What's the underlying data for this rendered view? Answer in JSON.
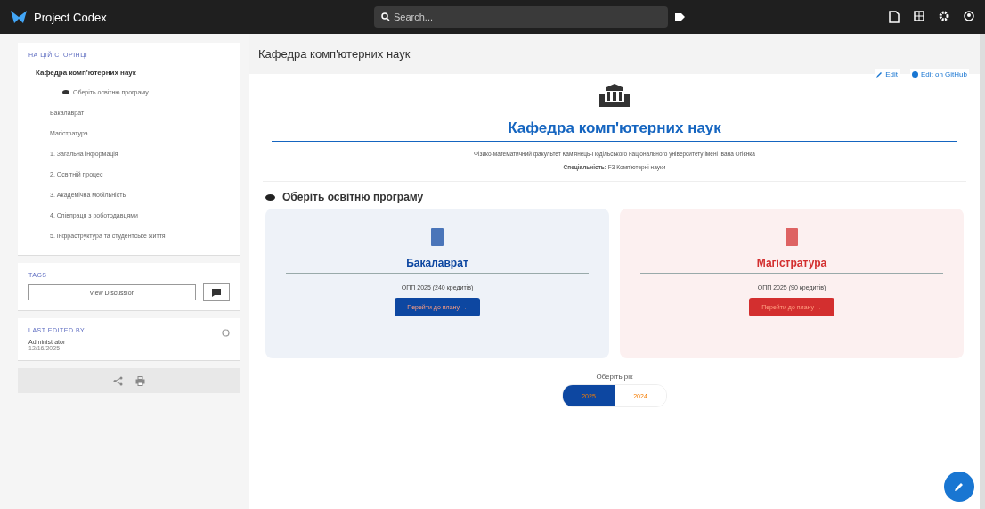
{
  "header": {
    "title": "Project Codex",
    "search": {
      "placeholder": "Search..."
    }
  },
  "sidebar": {
    "toc_title": "НА ЦІЙ СТОРІНЦІ",
    "toc": [
      {
        "label": "Кафедра комп'ютерних наук",
        "children": [
          {
            "label": "Оберіть освітню програму",
            "kind": "icon"
          },
          {
            "label": "Бакалаврат",
            "kind": "plain"
          },
          {
            "label": "Магістратура",
            "kind": "plain"
          },
          {
            "label": "1. Загальна інформація",
            "kind": "plain"
          },
          {
            "label": "2. Освітній процес",
            "kind": "plain"
          },
          {
            "label": "3. Академічна мобільність",
            "kind": "plain"
          },
          {
            "label": "4. Співпраця з роботодавцями",
            "kind": "plain"
          },
          {
            "label": "5. Інфраструктура та студентське життя",
            "kind": "plain"
          }
        ]
      }
    ],
    "tags_label": "TAGS",
    "discussion_button": "View Discussion",
    "edited_label": "LAST EDITED BY",
    "editor": "Administrator",
    "edited_date": "12/16/2025"
  },
  "page": {
    "title": "Кафедра комп'ютерних наук",
    "actions": [
      "Edit",
      "Edit on GitHub"
    ],
    "heading": "Кафедра комп'ютерних наук",
    "subtitle": "Фізико-математичний факультет Кам'янець-Подільського національного університету імені Івана Огієнка",
    "specialty": "**Спеціальність:** F3 Комп'ютерні науки",
    "section_title": "Оберіть освітню програму",
    "programs": [
      {
        "title": "Бакалаврат",
        "detail": "ОПП 2025 (240 кредитів)",
        "button": "Перейти до плану →",
        "color": "#0d47a1"
      },
      {
        "title": "Магістратура",
        "detail": "ОПП 2025 (90 кредитів)",
        "button": "Перейти до плану →",
        "color": "#d32f2f"
      }
    ],
    "year_label": "Оберіть рік",
    "years": [
      {
        "label": "2025",
        "selected": true
      },
      {
        "label": "2024",
        "selected": false
      }
    ]
  }
}
